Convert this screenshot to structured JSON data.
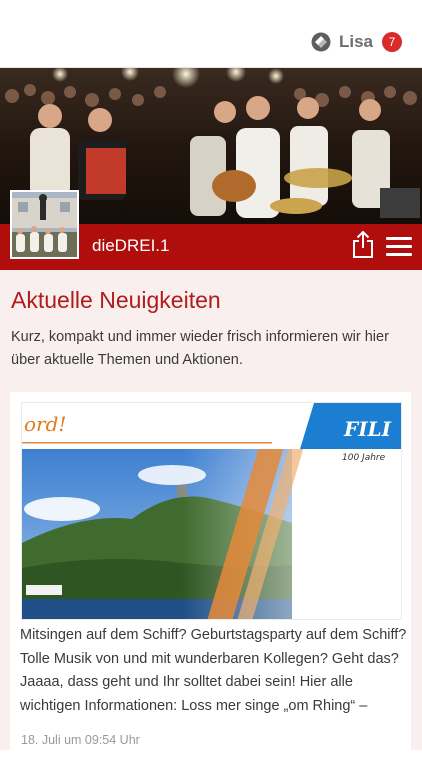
{
  "header": {
    "user_name": "Lisa",
    "notification_count": "7",
    "user_icon": "app-logo-icon"
  },
  "brand": {
    "name": "dieDREI.1",
    "color": "#b00d0d"
  },
  "news": {
    "title": "Aktuelle Neuigkeiten",
    "description": "Kurz, kompakt und immer wieder frisch informieren wir hier über aktuelle Themen und Aktionen.",
    "items": [
      {
        "banner_text_left": "ord!",
        "banner_text_right": "FILI",
        "banner_subtext": "100 Jahre",
        "text": "Mitsingen auf dem Schiff? Geburtstagsparty auf dem Schiff? Tolle Musik von und mit wunderbaren Kollegen? Geht das? Jaaaa, dass geht und Ihr solltet dabei sein! Hier alle wichtigen Informationen: Loss mer singe „om Rhing“ –",
        "date": "18. Juli um 09:54 Uhr"
      }
    ]
  }
}
